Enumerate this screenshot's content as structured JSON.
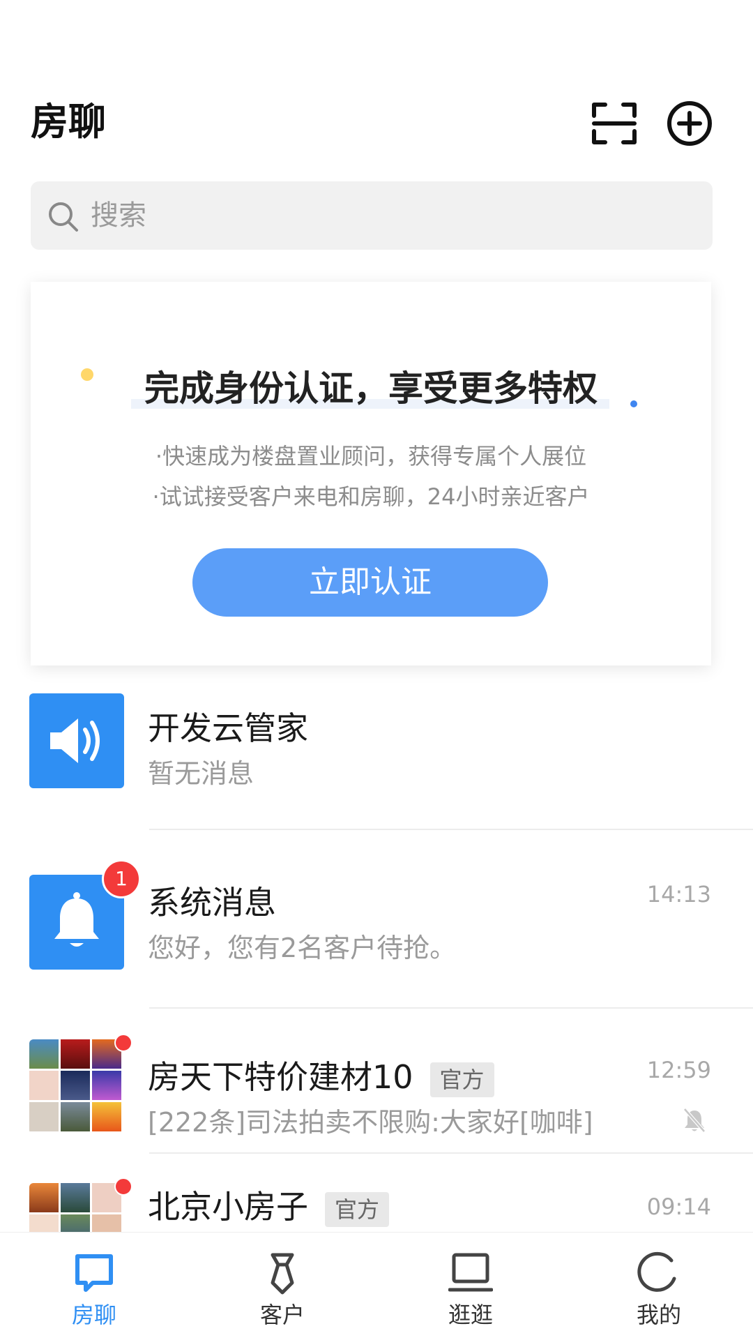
{
  "header": {
    "title": "房聊",
    "scan_icon": "scan-icon",
    "add_icon": "plus-circle-icon"
  },
  "search": {
    "placeholder": "搜索"
  },
  "verify_card": {
    "title": "完成身份认证，享受更多特权",
    "line1": "·快速成为楼盘置业顾问，获得专属个人展位",
    "line2": "·试试接受客户来电和房聊，24小时亲近客户",
    "button": "立即认证"
  },
  "conversations": [
    {
      "title": "开发云管家",
      "subtitle": "暂无消息",
      "time": "",
      "icon": "speaker-icon"
    },
    {
      "title": "系统消息",
      "subtitle": "您好，您有2名客户待抢。",
      "time": "14:13",
      "badge": "1",
      "icon": "bell-icon"
    },
    {
      "title": "房天下特价建材10",
      "tag": "官方",
      "subtitle": "[222条]司法拍卖不限购:大家好[咖啡]",
      "time": "12:59",
      "muted": true
    },
    {
      "title": "北京小房子",
      "tag": "官方",
      "subtitle": "",
      "time": "09:14"
    }
  ],
  "tabbar": [
    {
      "label": "房聊",
      "active": true
    },
    {
      "label": "客户"
    },
    {
      "label": "逛逛"
    },
    {
      "label": "我的"
    }
  ],
  "colors": {
    "accent": "#2f8ff3",
    "button": "#5b9ef8",
    "badge": "#f33a3a"
  }
}
